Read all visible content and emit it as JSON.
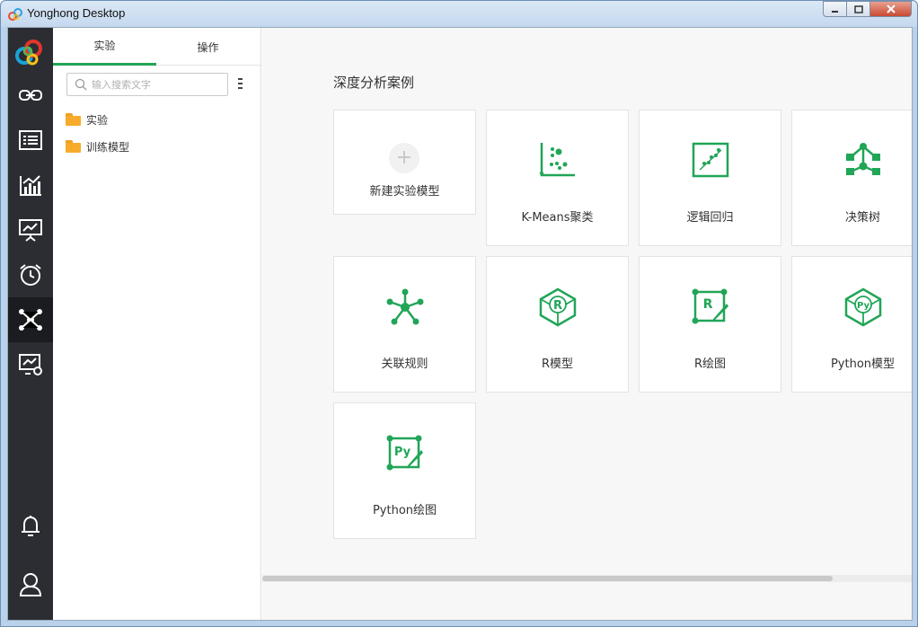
{
  "window": {
    "title": "Yonghong Desktop"
  },
  "leftbar": {
    "items": [
      {
        "name": "logo-icon"
      },
      {
        "name": "link-icon"
      },
      {
        "name": "list-icon"
      },
      {
        "name": "chart-icon"
      },
      {
        "name": "presentation-icon"
      },
      {
        "name": "alarm-clock-icon"
      },
      {
        "name": "network-icon",
        "active": true
      },
      {
        "name": "monitor-settings-icon"
      },
      {
        "name": "bell-icon"
      },
      {
        "name": "user-icon"
      }
    ]
  },
  "panel": {
    "tabs": [
      {
        "label": "实验",
        "active": true
      },
      {
        "label": "操作",
        "active": false
      }
    ],
    "search": {
      "placeholder": "输入搜索文字",
      "value": ""
    },
    "tree": [
      {
        "label": "实验",
        "icon": "folder-icon"
      },
      {
        "label": "训练模型",
        "icon": "folder-icon"
      }
    ]
  },
  "main": {
    "section_title": "深度分析案例",
    "cards": [
      {
        "label": "新建实验模型",
        "icon": "plus-icon"
      },
      {
        "label": "K-Means聚类",
        "icon": "scatter-icon"
      },
      {
        "label": "逻辑回归",
        "icon": "regression-icon"
      },
      {
        "label": "决策树",
        "icon": "tree-icon"
      },
      {
        "label": "关联规则",
        "icon": "association-icon"
      },
      {
        "label": "R模型",
        "icon": "r-model-icon"
      },
      {
        "label": "R绘图",
        "icon": "r-plot-icon"
      },
      {
        "label": "Python模型",
        "icon": "python-model-icon"
      },
      {
        "label": "Python绘图",
        "icon": "python-plot-icon"
      }
    ]
  },
  "colors": {
    "accent": "#21a557",
    "sidebar": "#2b2d33",
    "sidebar_active": "#1b1c20",
    "folder": "#f6ab2a",
    "background": "#f7f7f8"
  }
}
